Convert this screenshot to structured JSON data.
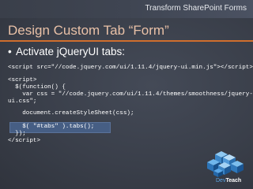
{
  "header": {
    "deck_title": "Transform SharePoint Forms"
  },
  "slide": {
    "title": "Design Custom Tab “Form”",
    "bullet_symbol": "•",
    "bullet_text": "Activate jQueryUI tabs:"
  },
  "code": {
    "line1": "<script src=\"//code.jquery.com/ui/1.11.4/jquery-ui.min.js\"></script>",
    "line2": "<script>",
    "line3": "  $(function() {",
    "line4": "    var css = \"//code.jquery.com/ui/1.11.4/themes/smoothness/jquery-",
    "line5": "ui.css\";",
    "line6": "    document.createStyleSheet(css);",
    "line7": "    $( \"#tabs\" ).tabs();",
    "line8": "  });",
    "line9": "</script>"
  },
  "logo": {
    "brand_prefix": "Dev",
    "brand_suffix": "Teach",
    "icon": "cube-stack-icon"
  },
  "colors": {
    "background": "#383d48",
    "title": "#e9c1a7",
    "divider": "#d06e2d",
    "highlight": "#465e84",
    "code_text": "#ffffff",
    "brand_dev": "#5aa7e8"
  }
}
